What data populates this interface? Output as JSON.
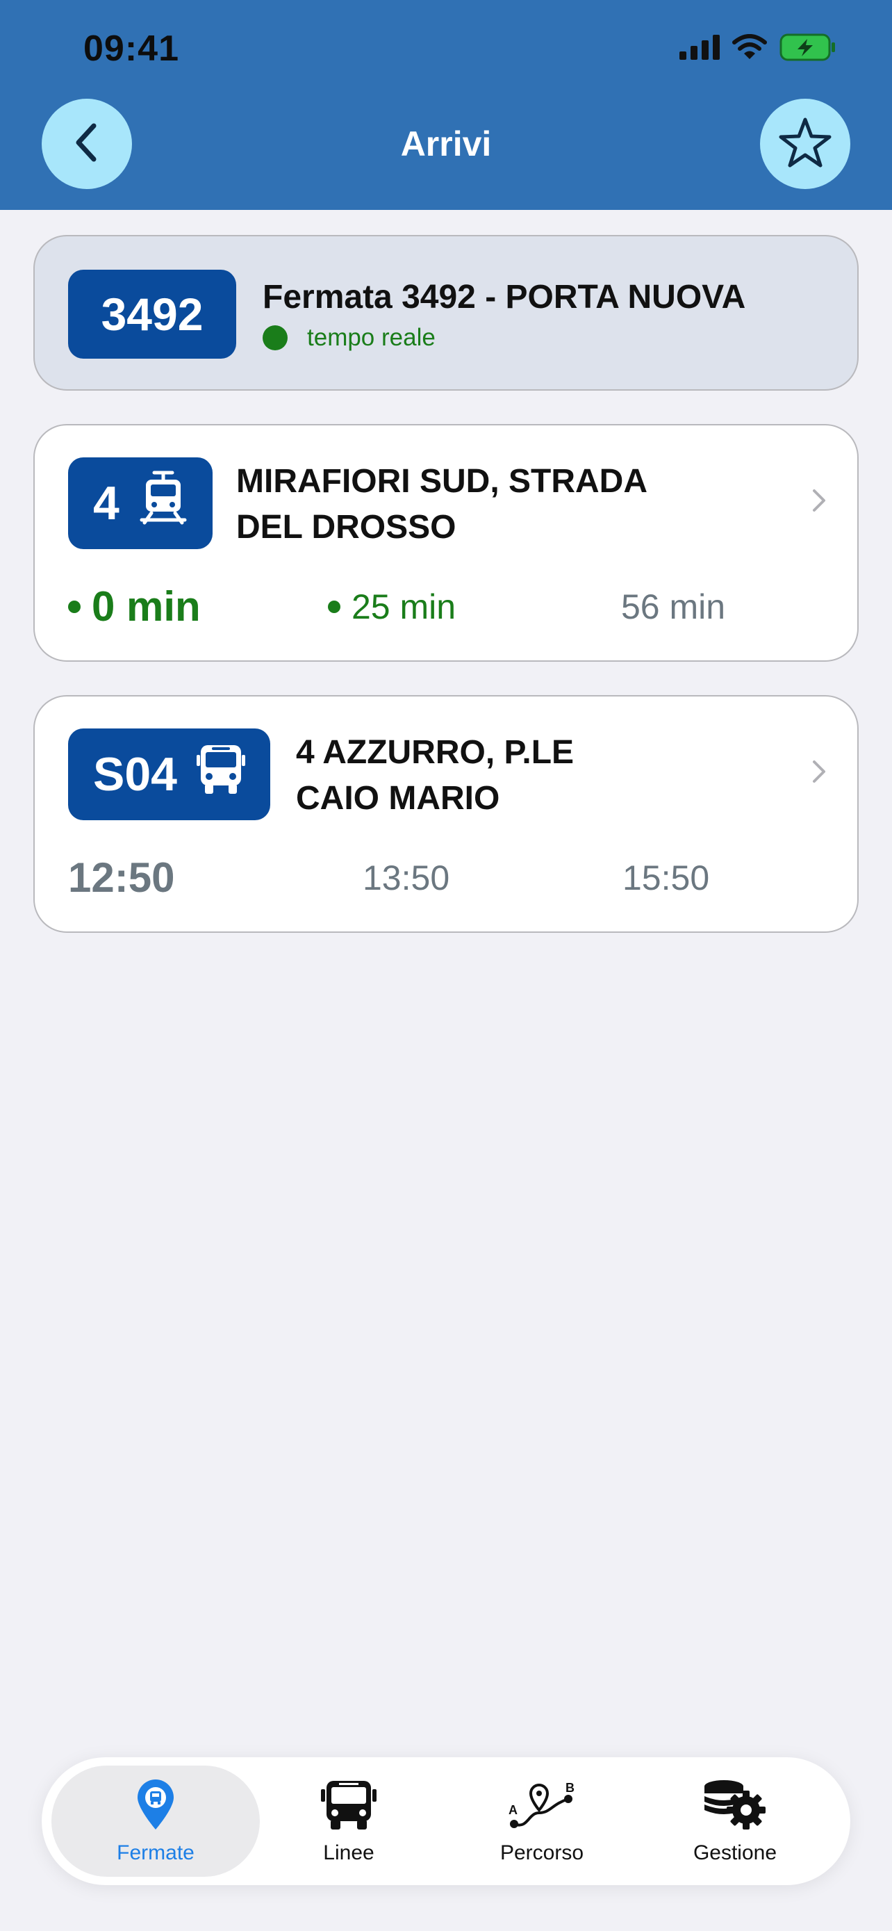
{
  "status_bar": {
    "time": "09:41"
  },
  "header": {
    "title": "Arrivi"
  },
  "stop": {
    "code": "3492",
    "title": "Fermata 3492 - PORTA NUOVA",
    "realtime_label": "tempo reale"
  },
  "lines": [
    {
      "code": "4",
      "vehicle": "tram-icon",
      "destination_line1": "MIRAFIORI SUD, STRADA",
      "destination_line2": "DEL DROSSO",
      "times": [
        "0 min",
        "25 min",
        "56 min"
      ]
    },
    {
      "code": "S04",
      "vehicle": "bus-icon",
      "destination_line1": "4 AZZURRO, P.LE",
      "destination_line2": "CAIO MARIO",
      "times": [
        "12:50",
        "13:50",
        "15:50"
      ]
    }
  ],
  "tabs": [
    {
      "label": "Fermate",
      "icon": "stop-pin-icon",
      "active": true
    },
    {
      "label": "Linee",
      "icon": "bus-icon",
      "active": false
    },
    {
      "label": "Percorso",
      "icon": "route-icon",
      "active": false
    },
    {
      "label": "Gestione",
      "icon": "database-gear-icon",
      "active": false
    }
  ],
  "colors": {
    "header": "#3071b4",
    "badge": "#0a4b9c",
    "realtime": "#1a7d1a",
    "active_tab": "#1d7fe6",
    "button_circle": "#a8e6fb"
  }
}
